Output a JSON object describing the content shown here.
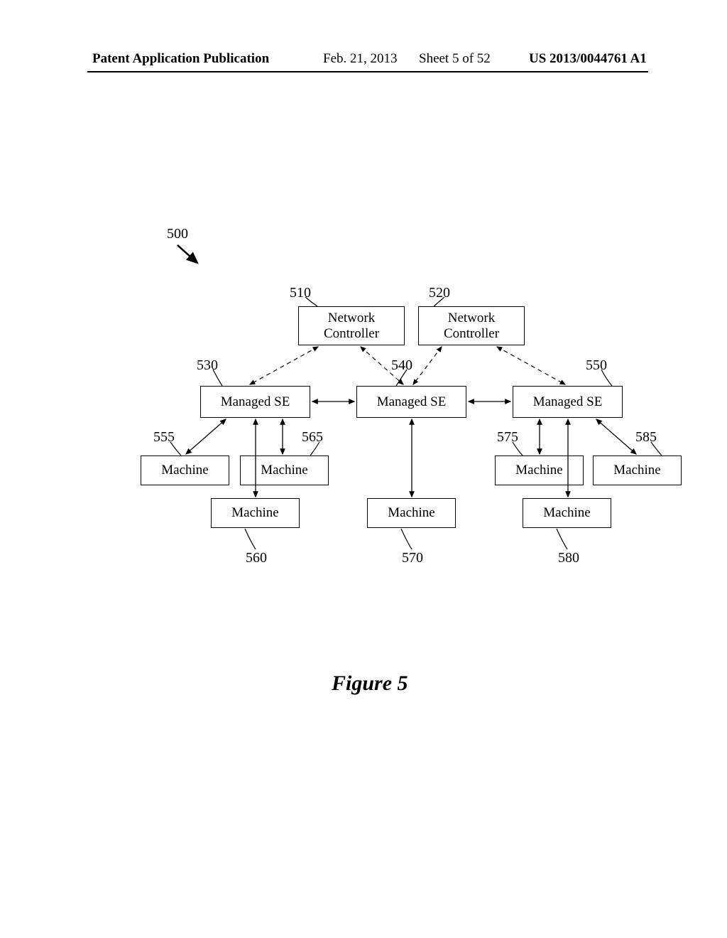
{
  "header": {
    "publication": "Patent Application Publication",
    "date": "Feb. 21, 2013",
    "sheet": "Sheet 5 of 52",
    "docnum": "US 2013/0044761 A1"
  },
  "refs": {
    "fig": "500",
    "nc1": "510",
    "nc2": "520",
    "se1": "530",
    "se2": "540",
    "se3": "550",
    "m555": "555",
    "m560": "560",
    "m565": "565",
    "m570": "570",
    "m575": "575",
    "m580": "580",
    "m585": "585"
  },
  "labels": {
    "nc": "Network\nController",
    "se": "Managed SE",
    "m": "Machine"
  },
  "caption": "Figure 5"
}
